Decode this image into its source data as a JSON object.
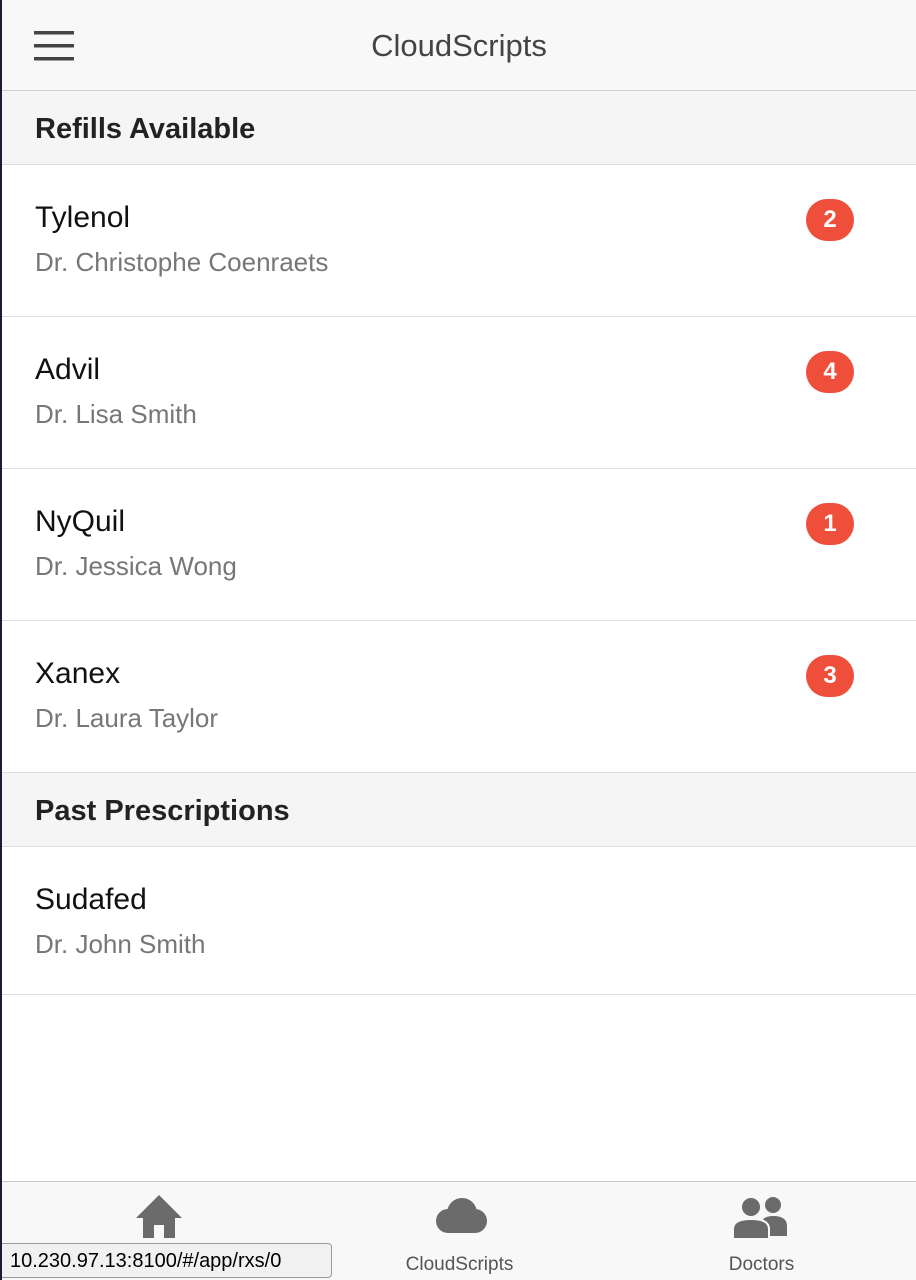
{
  "header": {
    "title": "CloudScripts"
  },
  "refills": {
    "title": "Refills Available",
    "items": [
      {
        "name": "Tylenol",
        "doctor": "Dr. Christophe Coenraets",
        "refills": "2"
      },
      {
        "name": "Advil",
        "doctor": "Dr. Lisa Smith",
        "refills": "4"
      },
      {
        "name": "NyQuil",
        "doctor": "Dr. Jessica Wong",
        "refills": "1"
      },
      {
        "name": "Xanex",
        "doctor": "Dr. Laura Taylor",
        "refills": "3"
      }
    ]
  },
  "past": {
    "title": "Past Prescriptions",
    "items": [
      {
        "name": "Sudafed",
        "doctor": "Dr. John Smith"
      }
    ]
  },
  "tabs": [
    {
      "label": "",
      "icon": "home-icon"
    },
    {
      "label": "CloudScripts",
      "icon": "cloud-icon"
    },
    {
      "label": "Doctors",
      "icon": "people-icon"
    }
  ],
  "status_bar": {
    "url": "10.230.97.13:8100/#/app/rxs/0"
  },
  "colors": {
    "badge": "#ef4e3a",
    "icon_gray": "#6b6b6b"
  }
}
